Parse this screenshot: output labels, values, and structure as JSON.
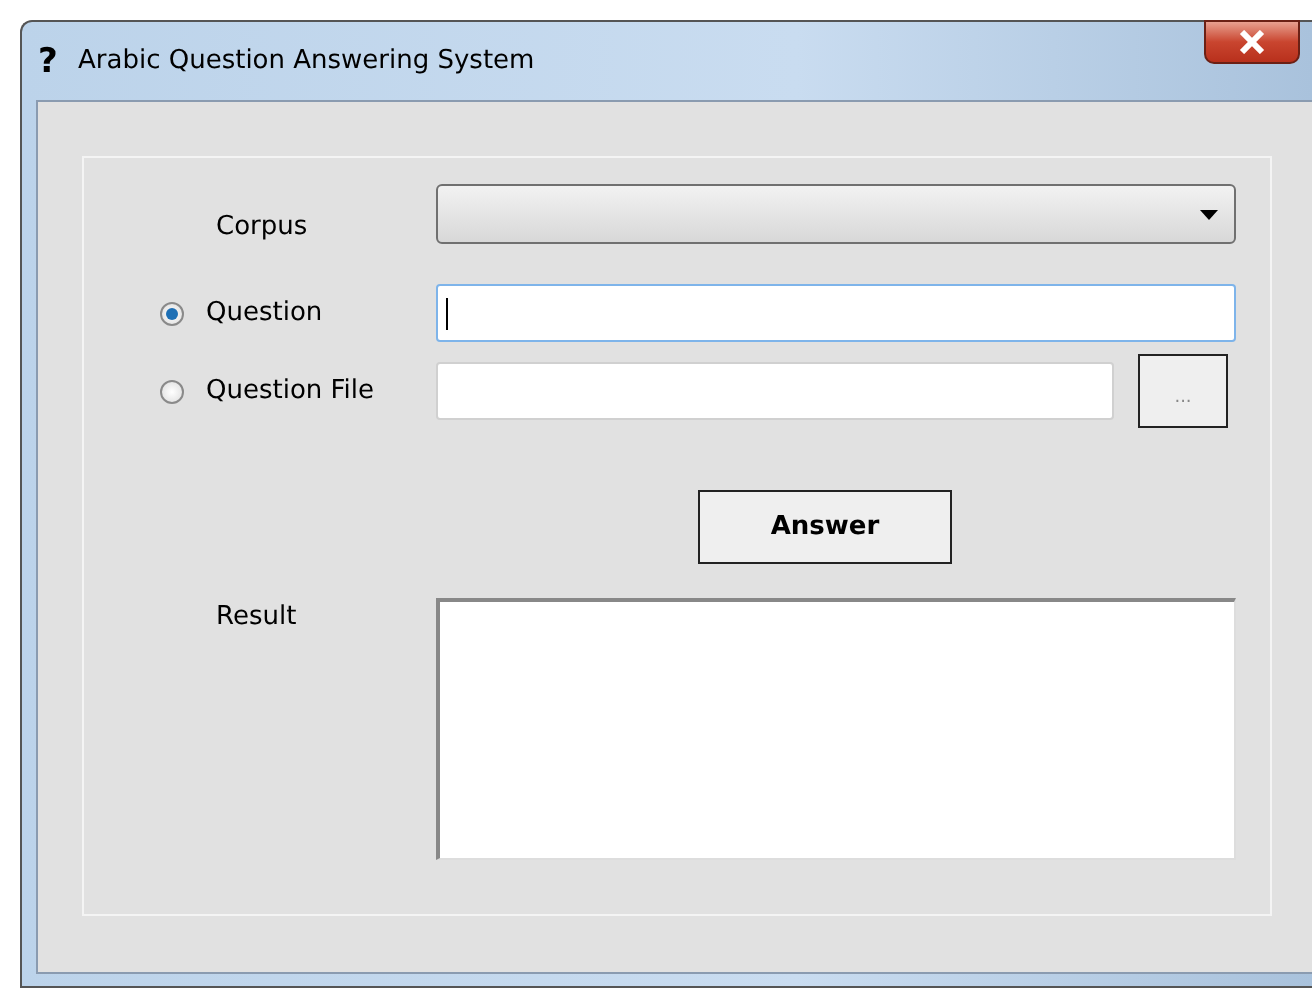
{
  "window": {
    "icon_glyph": "?",
    "title": "Arabic Question Answering  System"
  },
  "corpus": {
    "label": "Corpus"
  },
  "options": [
    {
      "label": "Question",
      "selected": true,
      "focused": true
    },
    {
      "label": "Question File",
      "selected": false,
      "focused": false
    }
  ],
  "browse_button": {
    "label": "..."
  },
  "answer_button": {
    "label": "Answer"
  },
  "result": {
    "label": "Result"
  }
}
